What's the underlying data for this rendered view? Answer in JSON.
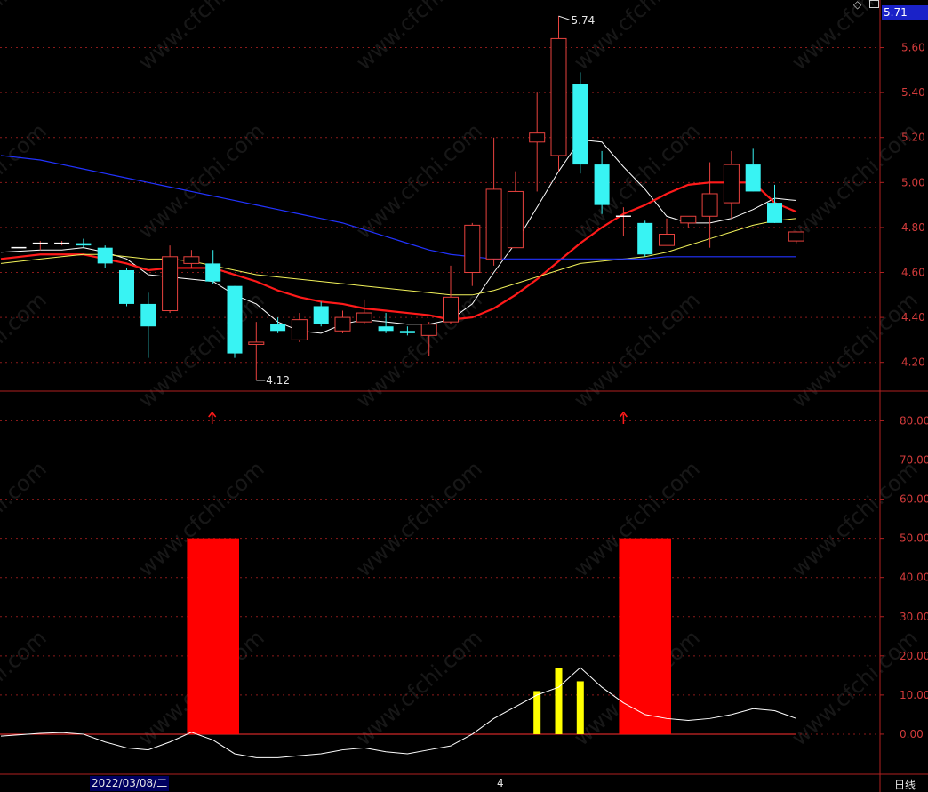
{
  "period_label": "日线",
  "date_label": "2022/03/08/二",
  "month_label": "4",
  "current_price": "5.71",
  "watermark": "www.cfchi.com",
  "icons": {
    "corner": "diamond-icon",
    "square": "restore-icon",
    "signal": "up-arrow-icon"
  },
  "colors": {
    "up_candle": "#e8423e",
    "down_candle": "#38f3f3",
    "ma5": "#ffffff",
    "ma10": "#ff1a1a",
    "ma20": "#f2f25a",
    "ma60": "#2233ff",
    "signal_bar": "#ff0000",
    "small_bar": "#ffff00",
    "grid": "#8a1a1a"
  },
  "chart_data": [
    {
      "type": "candlestick",
      "title": "",
      "ylim": [
        4.1,
        5.78
      ],
      "yticks": [
        "5.60",
        "5.40",
        "5.20",
        "5.00",
        "4.80",
        "4.60",
        "4.40",
        "4.20"
      ],
      "annotations": {
        "high": "5.74",
        "low": "4.12"
      },
      "candles": [
        {
          "o": 4.71,
          "c": 4.71,
          "h": 4.71,
          "l": 4.71
        },
        {
          "o": 4.73,
          "c": 4.73,
          "h": 4.74,
          "l": 4.7
        },
        {
          "o": 4.73,
          "c": 4.73,
          "h": 4.74,
          "l": 4.72
        },
        {
          "o": 4.73,
          "c": 4.72,
          "h": 4.75,
          "l": 4.71
        },
        {
          "o": 4.71,
          "c": 4.64,
          "h": 4.72,
          "l": 4.62
        },
        {
          "o": 4.61,
          "c": 4.46,
          "h": 4.62,
          "l": 4.45
        },
        {
          "o": 4.46,
          "c": 4.36,
          "h": 4.51,
          "l": 4.22
        },
        {
          "o": 4.43,
          "c": 4.67,
          "h": 4.72,
          "l": 4.42
        },
        {
          "o": 4.64,
          "c": 4.67,
          "h": 4.7,
          "l": 4.62
        },
        {
          "o": 4.64,
          "c": 4.56,
          "h": 4.7,
          "l": 4.55
        },
        {
          "o": 4.54,
          "c": 4.24,
          "h": 4.54,
          "l": 4.22
        },
        {
          "o": 4.28,
          "c": 4.29,
          "h": 4.38,
          "l": 4.12
        },
        {
          "o": 4.37,
          "c": 4.34,
          "h": 4.4,
          "l": 4.33
        },
        {
          "o": 4.3,
          "c": 4.39,
          "h": 4.42,
          "l": 4.29
        },
        {
          "o": 4.45,
          "c": 4.37,
          "h": 4.47,
          "l": 4.36
        },
        {
          "o": 4.34,
          "c": 4.4,
          "h": 4.43,
          "l": 4.33
        },
        {
          "o": 4.38,
          "c": 4.42,
          "h": 4.48,
          "l": 4.37
        },
        {
          "o": 4.36,
          "c": 4.34,
          "h": 4.42,
          "l": 4.33
        },
        {
          "o": 4.34,
          "c": 4.33,
          "h": 4.36,
          "l": 4.32
        },
        {
          "o": 4.32,
          "c": 4.37,
          "h": 4.38,
          "l": 4.23
        },
        {
          "o": 4.38,
          "c": 4.49,
          "h": 4.63,
          "l": 4.37
        },
        {
          "o": 4.6,
          "c": 4.81,
          "h": 4.82,
          "l": 4.54
        },
        {
          "o": 4.66,
          "c": 4.97,
          "h": 5.2,
          "l": 4.63
        },
        {
          "o": 4.71,
          "c": 4.96,
          "h": 5.05,
          "l": 4.71
        },
        {
          "o": 5.18,
          "c": 5.22,
          "h": 5.4,
          "l": 4.96
        },
        {
          "o": 5.12,
          "c": 5.64,
          "h": 5.74,
          "l": 5.05
        },
        {
          "o": 5.44,
          "c": 5.08,
          "h": 5.49,
          "l": 5.04
        },
        {
          "o": 5.08,
          "c": 4.9,
          "h": 5.14,
          "l": 4.86
        },
        {
          "o": 4.85,
          "c": 4.85,
          "h": 4.89,
          "l": 4.76
        },
        {
          "o": 4.82,
          "c": 4.68,
          "h": 4.83,
          "l": 4.67
        },
        {
          "o": 4.72,
          "c": 4.77,
          "h": 4.84,
          "l": 4.72
        },
        {
          "o": 4.82,
          "c": 4.85,
          "h": 4.85,
          "l": 4.8
        },
        {
          "o": 4.85,
          "c": 4.95,
          "h": 5.09,
          "l": 4.71
        },
        {
          "o": 4.91,
          "c": 5.08,
          "h": 5.14,
          "l": 4.84
        },
        {
          "o": 5.08,
          "c": 4.96,
          "h": 5.15,
          "l": 4.96
        },
        {
          "o": 4.91,
          "c": 4.82,
          "h": 4.99,
          "l": 4.82
        },
        {
          "o": 4.74,
          "c": 4.78,
          "h": 4.78,
          "l": 4.73
        }
      ],
      "series": [
        {
          "name": "MA5",
          "values": [
            4.69,
            4.7,
            4.7,
            4.71,
            4.69,
            4.66,
            4.59,
            4.58,
            4.57,
            4.56,
            4.5,
            4.46,
            4.38,
            4.34,
            4.33,
            4.37,
            4.39,
            4.38,
            4.37,
            4.37,
            4.39,
            4.46,
            4.6,
            4.73,
            4.89,
            5.05,
            5.19,
            5.18,
            5.07,
            4.97,
            4.85,
            4.82,
            4.82,
            4.84,
            4.88,
            4.93,
            4.92
          ]
        },
        {
          "name": "MA10",
          "values": [
            4.66,
            4.68,
            4.68,
            4.68,
            4.66,
            4.64,
            4.61,
            4.62,
            4.62,
            4.62,
            4.59,
            4.56,
            4.52,
            4.49,
            4.47,
            4.46,
            4.44,
            4.43,
            4.42,
            4.41,
            4.39,
            4.4,
            4.44,
            4.5,
            4.57,
            4.65,
            4.73,
            4.8,
            4.86,
            4.9,
            4.95,
            4.99,
            5.0,
            5.0,
            5.0,
            4.91,
            4.87
          ]
        },
        {
          "name": "MA20",
          "values": [
            4.64,
            4.66,
            4.67,
            4.68,
            4.68,
            4.67,
            4.66,
            4.66,
            4.65,
            4.63,
            4.61,
            4.59,
            4.58,
            4.57,
            4.56,
            4.55,
            4.54,
            4.53,
            4.52,
            4.51,
            4.5,
            4.5,
            4.52,
            4.55,
            4.58,
            4.61,
            4.64,
            4.65,
            4.66,
            4.67,
            4.69,
            4.72,
            4.75,
            4.78,
            4.81,
            4.83,
            4.84
          ]
        },
        {
          "name": "MA60",
          "values": [
            5.12,
            5.1,
            5.08,
            5.06,
            5.04,
            5.02,
            5.0,
            4.98,
            4.96,
            4.94,
            4.92,
            4.9,
            4.88,
            4.86,
            4.84,
            4.82,
            4.79,
            4.76,
            4.73,
            4.7,
            4.68,
            4.67,
            4.66,
            4.66,
            4.66,
            4.66,
            4.66,
            4.66,
            4.66,
            4.66,
            4.67,
            4.67,
            4.67,
            4.67,
            4.67,
            4.67,
            4.67
          ]
        }
      ]
    },
    {
      "type": "bar",
      "title": "",
      "ylim": [
        -10,
        86
      ],
      "yticks": [
        "80.00",
        "70.00",
        "60.00",
        "50.00",
        "40.00",
        "30.00",
        "20.00",
        "10.00",
        "0.00"
      ],
      "series": [
        {
          "name": "",
          "type": "line",
          "values": [
            -0.5,
            0.2,
            0.4,
            0.0,
            -2.0,
            -3.5,
            -4.0,
            -2.0,
            0.5,
            -1.5,
            -5.0,
            -6.0,
            -6.0,
            -5.5,
            -5.0,
            -4.0,
            -3.5,
            -4.5,
            -5.0,
            -4.0,
            -3.0,
            0.0,
            4.0,
            7.0,
            10.0,
            12.0,
            17.0,
            12.0,
            8.0,
            5.0,
            4.0,
            3.5,
            4.0,
            5.0,
            6.5,
            6.0,
            4.0
          ]
        }
      ],
      "signal_bars": [
        {
          "index_start": 8,
          "index_end": 10,
          "value": 50
        },
        {
          "index_start": 28,
          "index_end": 30,
          "value": 50
        }
      ],
      "small_bars": [
        {
          "index": 24,
          "value": 11
        },
        {
          "index": 25,
          "value": 17
        },
        {
          "index": 26,
          "value": 13.5
        }
      ],
      "signal_arrow_indices": [
        9,
        28
      ]
    }
  ]
}
